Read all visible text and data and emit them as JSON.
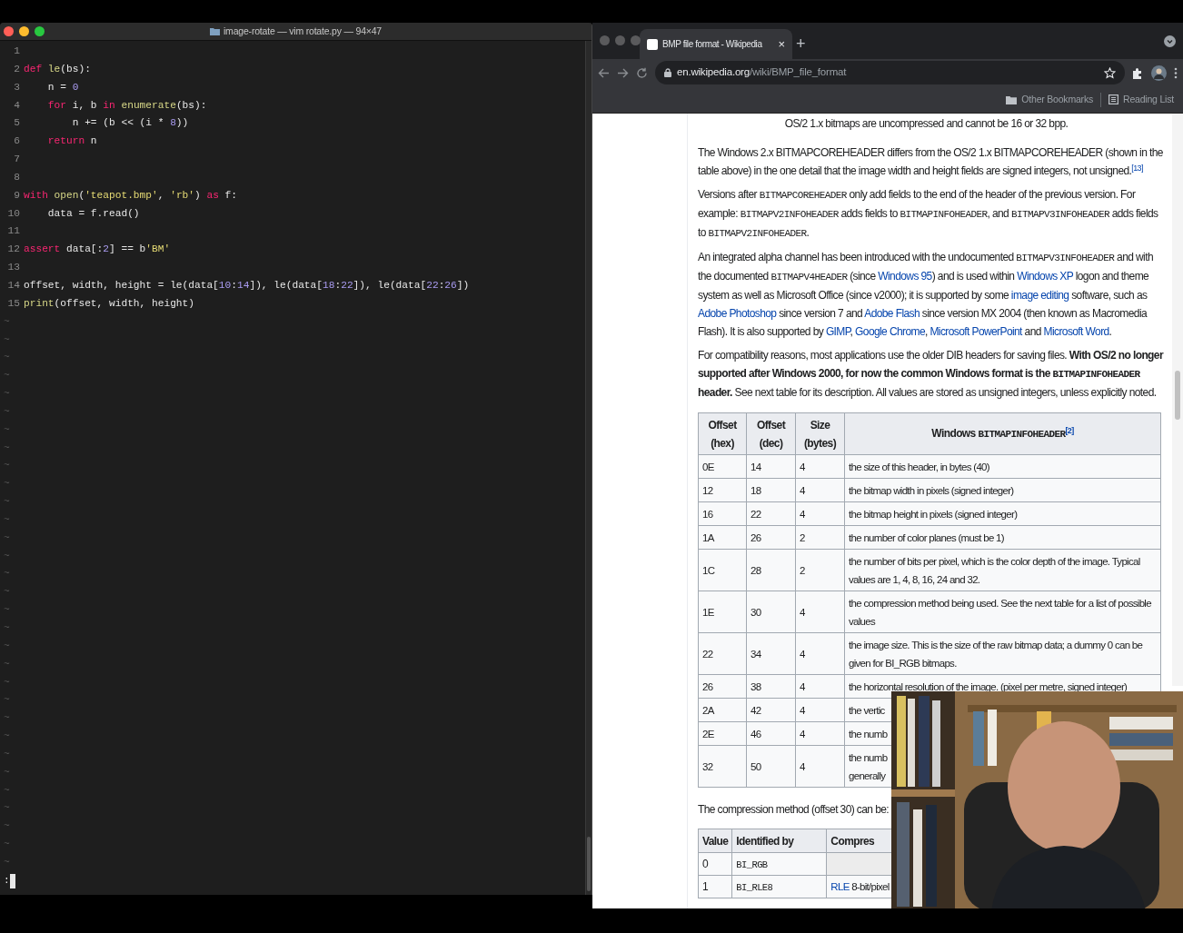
{
  "terminal": {
    "title": "image-rotate — vim rotate.py — 94×47",
    "lines": [
      {
        "number": "1"
      },
      {
        "number": "2",
        "tokens": [
          {
            "kind": "keyword",
            "text": "def"
          },
          {
            "kind": "function",
            "text": " le"
          },
          {
            "kind": "plain",
            "text": "(bs):"
          }
        ]
      },
      {
        "number": "3",
        "tokens": [
          {
            "kind": "plain",
            "text": "    n = "
          },
          {
            "kind": "number",
            "text": "0"
          }
        ]
      },
      {
        "number": "4",
        "tokens": [
          {
            "kind": "keyword",
            "text": "    for"
          },
          {
            "kind": "plain",
            "text": " i, b "
          },
          {
            "kind": "keyword",
            "text": "in"
          },
          {
            "kind": "function",
            "text": " enumerate"
          },
          {
            "kind": "plain",
            "text": "(bs):"
          }
        ]
      },
      {
        "number": "5",
        "tokens": [
          {
            "kind": "plain",
            "text": "        n += (b << (i * "
          },
          {
            "kind": "number",
            "text": "8"
          },
          {
            "kind": "plain",
            "text": "))"
          }
        ]
      },
      {
        "number": "6",
        "tokens": [
          {
            "kind": "keyword",
            "text": "    return"
          },
          {
            "kind": "plain",
            "text": " n"
          }
        ]
      },
      {
        "number": "7"
      },
      {
        "number": "8"
      },
      {
        "number": "9",
        "tokens": [
          {
            "kind": "keyword",
            "text": "with"
          },
          {
            "kind": "function",
            "text": " open"
          },
          {
            "kind": "plain",
            "text": "("
          },
          {
            "kind": "string",
            "text": "'teapot.bmp'"
          },
          {
            "kind": "plain",
            "text": ", "
          },
          {
            "kind": "string",
            "text": "'rb'"
          },
          {
            "kind": "plain",
            "text": ") "
          },
          {
            "kind": "keyword",
            "text": "as"
          },
          {
            "kind": "plain",
            "text": " f:"
          }
        ]
      },
      {
        "number": "10",
        "tokens": [
          {
            "kind": "plain",
            "text": "    data = f.read()"
          }
        ]
      },
      {
        "number": "11"
      },
      {
        "number": "12",
        "tokens": [
          {
            "kind": "keyword",
            "text": "assert"
          },
          {
            "kind": "plain",
            "text": " data[:"
          },
          {
            "kind": "number",
            "text": "2"
          },
          {
            "kind": "plain",
            "text": "] == b"
          },
          {
            "kind": "string",
            "text": "'BM'"
          }
        ]
      },
      {
        "number": "13"
      },
      {
        "number": "14",
        "tokens": [
          {
            "kind": "plain",
            "text": "offset, width, height = le(data["
          },
          {
            "kind": "number",
            "text": "10"
          },
          {
            "kind": "plain",
            "text": ":"
          },
          {
            "kind": "number",
            "text": "14"
          },
          {
            "kind": "plain",
            "text": "]), le(data["
          },
          {
            "kind": "number",
            "text": "18"
          },
          {
            "kind": "plain",
            "text": ":"
          },
          {
            "kind": "number",
            "text": "22"
          },
          {
            "kind": "plain",
            "text": "]), le(data["
          },
          {
            "kind": "number",
            "text": "22"
          },
          {
            "kind": "plain",
            "text": ":"
          },
          {
            "kind": "number",
            "text": "26"
          },
          {
            "kind": "plain",
            "text": "])"
          }
        ]
      },
      {
        "number": "15",
        "tokens": [
          {
            "kind": "function",
            "text": "print"
          },
          {
            "kind": "plain",
            "text": "(offset, width, height)"
          }
        ]
      }
    ],
    "filler_lines": [
      "~",
      "~",
      "~",
      "~",
      "~",
      "~",
      "~",
      "~",
      "~",
      "~",
      "~",
      "~",
      "~",
      "~",
      "~",
      "~",
      "~",
      "~",
      "~",
      "~",
      "~",
      "~",
      "~",
      "~",
      "~",
      "~",
      "~",
      "~",
      "~",
      "~",
      "~"
    ],
    "command_line": ":"
  },
  "browser": {
    "tabs": [
      {
        "title": "BMP file format - Wikipedia",
        "close": "×",
        "selected": true
      }
    ],
    "new_tab": "+",
    "url": {
      "domain": "en.wikipedia.org",
      "path": "/wiki/BMP_file_format"
    },
    "bookmarks": [
      "Other Bookmarks",
      "Reading List"
    ],
    "page": {
      "caption": "OS/2 1.x bitmaps are uncompressed and cannot be 16 or 32 bpp.",
      "paragraphs": [
        [
          {
            "kind": "plain",
            "text": "The Windows 2.x BITMAPCOREHEADER differs from the OS/2 1.x BITMAPCOREHEADER (shown in the table above) in the one detail that the image width and height fields are signed integers, not unsigned."
          },
          {
            "kind": "ref",
            "text": "[13]"
          }
        ],
        [
          {
            "kind": "plain",
            "text": "Versions after "
          },
          {
            "kind": "code",
            "text": "BITMAPCOREHEADER"
          },
          {
            "kind": "plain",
            "text": " only add fields to the end of the header of the previous version. For example: "
          },
          {
            "kind": "code",
            "text": "BITMAPV2INFOHEADER"
          },
          {
            "kind": "plain",
            "text": " adds fields to "
          },
          {
            "kind": "code",
            "text": "BITMAPINFOHEADER"
          },
          {
            "kind": "plain",
            "text": ", and "
          },
          {
            "kind": "code",
            "text": "BITMAPV3INFOHEADER"
          },
          {
            "kind": "plain",
            "text": " adds fields to "
          },
          {
            "kind": "code",
            "text": "BITMAPV2INFOHEADER"
          },
          {
            "kind": "plain",
            "text": "."
          }
        ],
        [
          {
            "kind": "plain",
            "text": "An integrated alpha channel has been introduced with the undocumented "
          },
          {
            "kind": "code",
            "text": "BITMAPV3INFOHEADER"
          },
          {
            "kind": "plain",
            "text": " and with the documented "
          },
          {
            "kind": "code",
            "text": "BITMAPV4HEADER"
          },
          {
            "kind": "plain",
            "text": " (since "
          },
          {
            "kind": "link",
            "text": "Windows 95"
          },
          {
            "kind": "plain",
            "text": ") and is used within "
          },
          {
            "kind": "link",
            "text": "Windows XP"
          },
          {
            "kind": "plain",
            "text": " logon and theme system as well as Microsoft Office (since v2000); it is supported by some "
          },
          {
            "kind": "link",
            "text": "image editing"
          },
          {
            "kind": "plain",
            "text": " software, such as "
          },
          {
            "kind": "link",
            "text": "Adobe Photoshop"
          },
          {
            "kind": "plain",
            "text": " since version 7 and "
          },
          {
            "kind": "link",
            "text": "Adobe Flash"
          },
          {
            "kind": "plain",
            "text": " since version MX 2004 (then known as Macromedia Flash). It is also supported by "
          },
          {
            "kind": "link",
            "text": "GIMP"
          },
          {
            "kind": "plain",
            "text": ", "
          },
          {
            "kind": "link",
            "text": "Google Chrome"
          },
          {
            "kind": "plain",
            "text": ", "
          },
          {
            "kind": "link",
            "text": "Microsoft PowerPoint"
          },
          {
            "kind": "plain",
            "text": " and "
          },
          {
            "kind": "link",
            "text": "Microsoft Word"
          },
          {
            "kind": "plain",
            "text": "."
          }
        ],
        [
          {
            "kind": "plain",
            "text": "For compatibility reasons, most applications use the older DIB headers for saving files. "
          },
          {
            "kind": "bold",
            "text": "With OS/2 no longer supported after Windows 2000, for now the common Windows format is the "
          },
          {
            "kind": "boldcode",
            "text": "BITMAPINFOHEADER"
          },
          {
            "kind": "bold",
            "text": " header."
          },
          {
            "kind": "plain",
            "text": " See next table for its description. All values are stored as unsigned integers, unless explicitly noted."
          }
        ]
      ],
      "header_table": {
        "columns": [
          {
            "label": [
              {
                "kind": "plain",
                "text": "Offset (hex)"
              }
            ]
          },
          {
            "label": [
              {
                "kind": "plain",
                "text": "Offset (dec)"
              }
            ]
          },
          {
            "label": [
              {
                "kind": "plain",
                "text": "Size (bytes)"
              }
            ]
          },
          {
            "label": [
              {
                "kind": "plain",
                "text": "Windows "
              },
              {
                "kind": "code",
                "text": "BITMAPINFOHEADER"
              },
              {
                "kind": "ref",
                "text": "[2]"
              }
            ]
          }
        ],
        "rows": [
          [
            "0E",
            "14",
            "4",
            "the size of this header, in bytes (40)"
          ],
          [
            "12",
            "18",
            "4",
            "the bitmap width in pixels (signed integer)"
          ],
          [
            "16",
            "22",
            "4",
            "the bitmap height in pixels (signed integer)"
          ],
          [
            "1A",
            "26",
            "2",
            "the number of color planes (must be 1)"
          ],
          [
            "1C",
            "28",
            "2",
            "the number of bits per pixel, which is the color depth of the image. Typical values are 1, 4, 8, 16, 24 and 32."
          ],
          [
            "1E",
            "30",
            "4",
            "the compression method being used. See the next table for a list of possible values"
          ],
          [
            "22",
            "34",
            "4",
            "the image size. This is the size of the raw bitmap data; a dummy 0 can be given for BI_RGB bitmaps."
          ],
          [
            "26",
            "38",
            "4",
            "the horizontal resolution of the image. (pixel per metre, signed integer)"
          ],
          [
            "2A",
            "42",
            "4",
            "the vertic"
          ],
          [
            "2E",
            "46",
            "4",
            "the numb"
          ],
          [
            "32",
            "50",
            "4",
            "the numb\ngenerally"
          ]
        ]
      },
      "compression_intro": "The compression method (offset 30) can be:",
      "compression_table": {
        "columns": [
          "Value",
          "Identified by",
          "Compres"
        ],
        "rows": [
          {
            "value": "0",
            "identifier": "BI_RGB"
          },
          {
            "value": "1",
            "identifier": "BI_RLE8",
            "compression": [
              {
                "kind": "link",
                "text": "RLE"
              },
              {
                "kind": "plain",
                "text": " 8-bit/pixel"
              }
            ]
          }
        ]
      }
    }
  }
}
